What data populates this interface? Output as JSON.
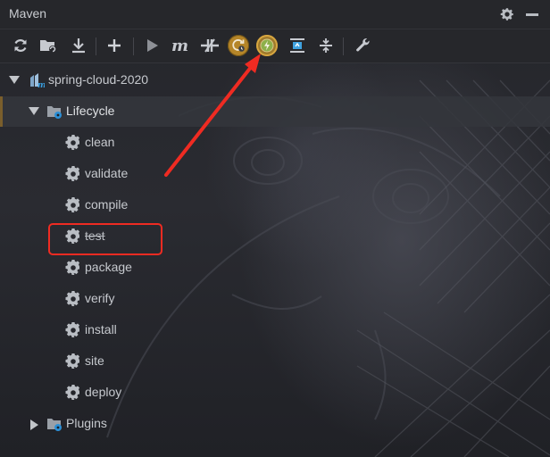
{
  "window": {
    "title": "Maven"
  },
  "toolbar": {
    "buttons": [
      {
        "icon": "reload-icon"
      },
      {
        "icon": "add-folder-icon"
      },
      {
        "icon": "download-icon"
      },
      {
        "icon": "plus-icon"
      },
      {
        "icon": "run-icon"
      },
      {
        "icon": "maven-m-icon"
      },
      {
        "icon": "toggle-offline-icon"
      },
      {
        "icon": "toggle-skip-tests-icon"
      },
      {
        "icon": "lightning-icon"
      },
      {
        "icon": "show-dependencies-icon"
      },
      {
        "icon": "collapse-all-icon"
      },
      {
        "icon": "wrench-icon"
      }
    ],
    "accent": "#b58528"
  },
  "tree": {
    "project": {
      "label": "spring-cloud-2020",
      "expanded": true
    },
    "lifecycle": {
      "label": "Lifecycle",
      "expanded": true
    },
    "goals": [
      "clean",
      "validate",
      "compile",
      "test",
      "package",
      "verify",
      "install",
      "site",
      "deploy"
    ],
    "struck_goal": "test",
    "plugins": {
      "label": "Plugins",
      "expanded": false
    }
  },
  "annotation": {
    "color": "#ef2b22"
  }
}
